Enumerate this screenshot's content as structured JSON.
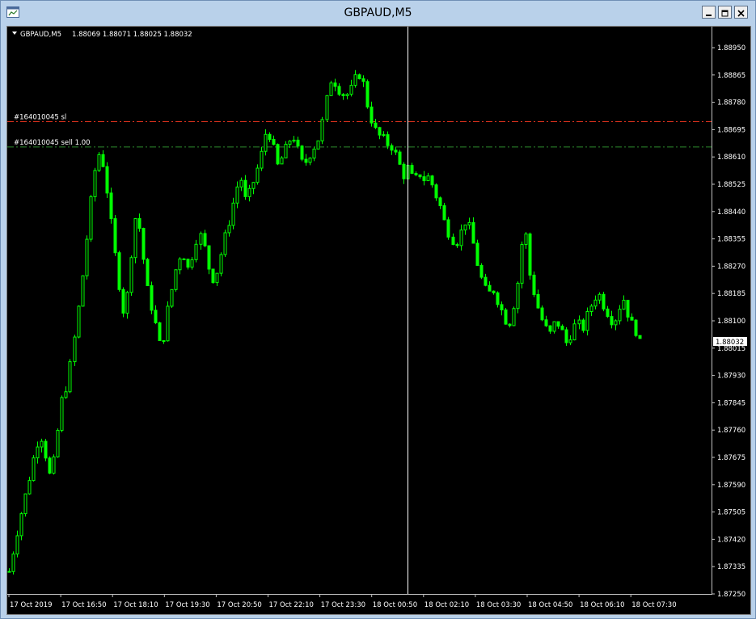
{
  "window": {
    "title": "GBPAUD,M5",
    "icon": "chart-window-icon"
  },
  "header_info": {
    "symbol_label": "GBPAUD,M5",
    "ohlc": "1.88069 1.88071 1.88025 1.88032"
  },
  "order_lines": [
    {
      "label": "#164010045 sl",
      "price": 1.8872,
      "color": "#d8301c"
    },
    {
      "label": "#164010045 sell 1.00",
      "price": 1.88641,
      "color": "#2e8b2e"
    }
  ],
  "current_price_label": "1.88032",
  "price_axis": {
    "labels": [
      "1.88950",
      "1.88865",
      "1.88780",
      "1.88695",
      "1.88610",
      "1.88525",
      "1.88440",
      "1.88355",
      "1.88270",
      "1.88185",
      "1.88100",
      "1.88015",
      "1.87930",
      "1.87845",
      "1.87760",
      "1.87675",
      "1.87590",
      "1.87505",
      "1.87420",
      "1.87335",
      "1.87250"
    ]
  },
  "time_axis": {
    "labels": [
      "17 Oct 2019",
      "17 Oct 16:50",
      "17 Oct 18:10",
      "17 Oct 19:30",
      "17 Oct 20:50",
      "17 Oct 22:10",
      "17 Oct 23:30",
      "18 Oct 00:50",
      "18 Oct 02:10",
      "18 Oct 03:30",
      "18 Oct 04:50",
      "18 Oct 06:10",
      "18 Oct 07:30"
    ]
  },
  "colors": {
    "background": "#000000",
    "candle": "#00ff00",
    "axis_text": "#ffffff",
    "crosshair": "#ffffff"
  },
  "chart_data": {
    "type": "candlestick",
    "symbol": "GBPAUD",
    "timeframe": "M5",
    "ylim": [
      1.8725,
      1.8899
    ],
    "close_path": [
      1.8732,
      1.874,
      1.8748,
      1.8755,
      1.8762,
      1.877,
      1.8775,
      1.8768,
      1.876,
      1.8772,
      1.8785,
      1.879,
      1.88,
      1.8812,
      1.8825,
      1.884,
      1.8855,
      1.8862,
      1.8858,
      1.8845,
      1.8832,
      1.882,
      1.881,
      1.8828,
      1.8842,
      1.8838,
      1.8822,
      1.8815,
      1.8808,
      1.88,
      1.8812,
      1.882,
      1.8828,
      1.8832,
      1.8826,
      1.8831,
      1.8838,
      1.8834,
      1.8826,
      1.8822,
      1.8829,
      1.8836,
      1.8842,
      1.885,
      1.8855,
      1.8847,
      1.8851,
      1.8856,
      1.8862,
      1.887,
      1.8866,
      1.8858,
      1.8861,
      1.8865,
      1.8868,
      1.8863,
      1.8858,
      1.8861,
      1.8864,
      1.8867,
      1.8875,
      1.8885,
      1.8884,
      1.8881,
      1.888,
      1.8882,
      1.8886,
      1.8887,
      1.8878,
      1.8872,
      1.8868,
      1.8867,
      1.8865,
      1.8864,
      1.886,
      1.8855,
      1.8858,
      1.8853,
      1.8856,
      1.8854,
      1.8855,
      1.885,
      1.8846,
      1.884,
      1.8836,
      1.8834,
      1.8838,
      1.8842,
      1.8836,
      1.8828,
      1.8822,
      1.8818,
      1.882,
      1.8816,
      1.8812,
      1.8808,
      1.8815,
      1.8824,
      1.8842,
      1.8825,
      1.8818,
      1.8812,
      1.8808,
      1.8806,
      1.881,
      1.8808,
      1.8803,
      1.8806,
      1.881,
      1.8807,
      1.8812,
      1.8816,
      1.8819,
      1.8815,
      1.8812,
      1.8809,
      1.8814,
      1.8817,
      1.881,
      1.8808,
      1.8803
    ]
  }
}
